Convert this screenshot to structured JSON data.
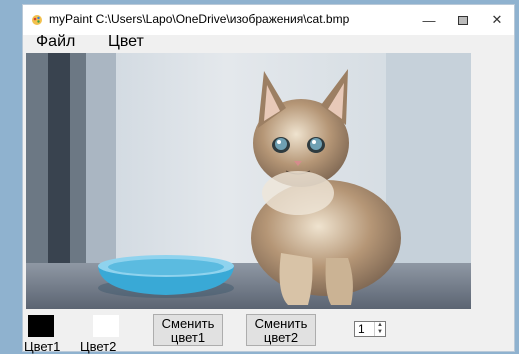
{
  "window": {
    "title": "myPaint C:\\Users\\Lapo\\OneDrive\\изображения\\cat.bmp",
    "minimize_icon": "minimize-icon",
    "maximize_icon": "maximize-icon",
    "close_icon": "close-icon"
  },
  "menu": {
    "file": "Файл",
    "color": "Цвет"
  },
  "canvas": {
    "image_description_icon": "kitten-photo"
  },
  "controls": {
    "color1_label": "Цвет1",
    "color2_label": "Цвет2",
    "color1_value": "#000000",
    "color2_value": "#ffffff",
    "change_color1_line1": "Сменить",
    "change_color1_line2": "цвет1",
    "change_color2_line1": "Сменить",
    "change_color2_line2": "цвет2",
    "brush_size": "1"
  }
}
